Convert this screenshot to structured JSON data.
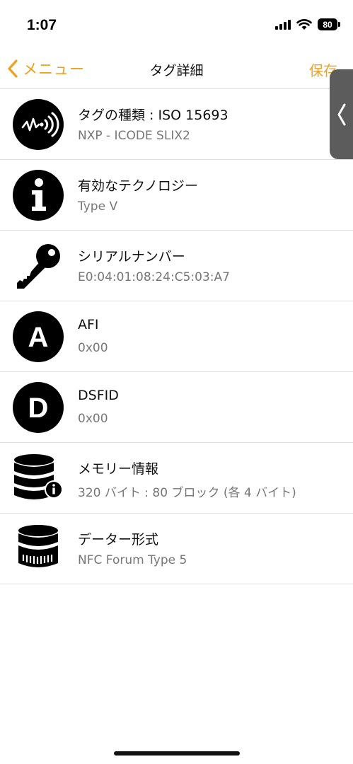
{
  "status_bar": {
    "time": "1:07",
    "battery": "80"
  },
  "nav": {
    "back_label": "メニュー",
    "title": "タグ詳細",
    "save_label": "保存",
    "accent_color": "#f0a020"
  },
  "rows": [
    {
      "icon": "nfc-icon",
      "title": "タグの種類 : ISO 15693",
      "subtitle": "NXP - ICODE SLIX2"
    },
    {
      "icon": "info-icon",
      "title": "有効なテクノロジー",
      "subtitle": "Type V"
    },
    {
      "icon": "key-icon",
      "title": "シリアルナンバー",
      "subtitle": "E0:04:01:08:24:C5:03:A7"
    },
    {
      "icon": "letter-a-icon",
      "title": "AFI",
      "subtitle": "0x00"
    },
    {
      "icon": "letter-d-icon",
      "title": "DSFID",
      "subtitle": "0x00"
    },
    {
      "icon": "database-info-icon",
      "title": "メモリー情報",
      "subtitle": "320 バイト : 80 ブロック (各 4 バイト)"
    },
    {
      "icon": "database-format-icon",
      "title": "データー形式",
      "subtitle": "NFC Forum Type 5"
    }
  ]
}
